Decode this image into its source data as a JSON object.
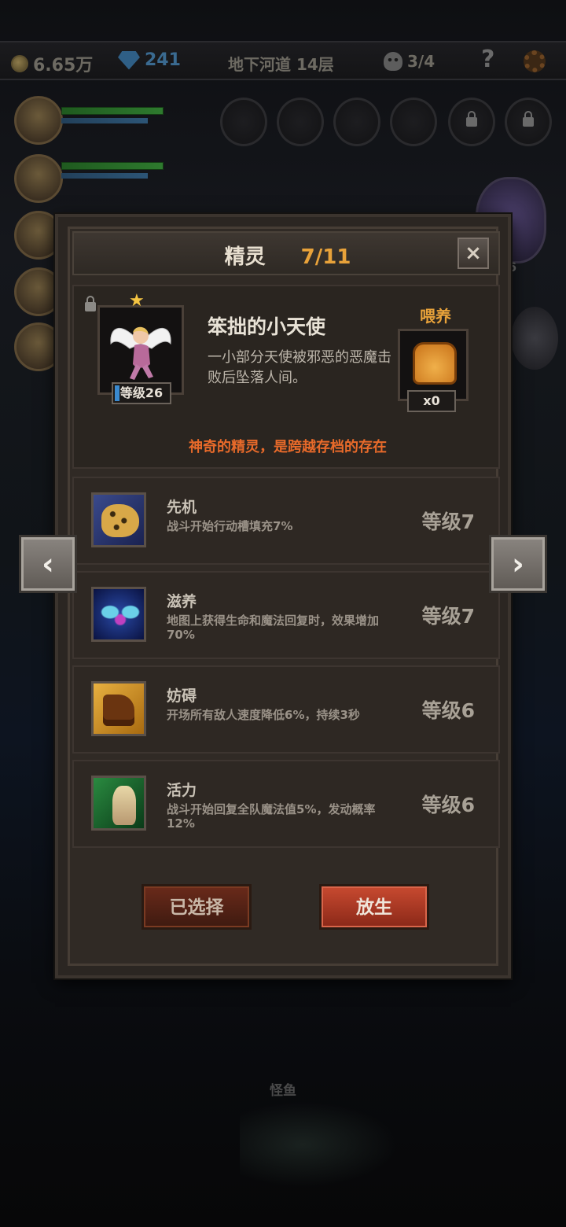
{
  "status_bar": {
    "gold": "6.65万",
    "gems": "241",
    "location": "地下河道 14层",
    "skull_progress": "3/4",
    "help": "?"
  },
  "background": {
    "monster_label": "怪鱼",
    "side_badge": "6"
  },
  "dialog": {
    "title": "精灵",
    "count": "7/11",
    "close": "×",
    "spirit": {
      "name": "笨拙的小天使",
      "description": "一小部分天使被邪恶的恶魔击败后坠落人间。",
      "level": "等级26",
      "stars": 1,
      "locked": true
    },
    "feed": {
      "label": "喂养",
      "item": "bread-icon",
      "count": "x0"
    },
    "flavor": "神奇的精灵，是跨越存档的存在",
    "skills": [
      {
        "name": "先机",
        "desc": "战斗开始行动槽填充7%",
        "level": "等级7",
        "icon": "leopard-icon"
      },
      {
        "name": "滋养",
        "desc": "地图上获得生命和魔法回复时，效果增加70%",
        "level": "等级7",
        "icon": "fairy-icon"
      },
      {
        "name": "妨碍",
        "desc": "开场所有敌人速度降低6%，持续3秒",
        "level": "等级6",
        "icon": "chained-boot-icon"
      },
      {
        "name": "活力",
        "desc": "战斗开始回复全队魔法值5%，发动概率12%",
        "level": "等级6",
        "icon": "vitality-icon"
      }
    ],
    "buttons": {
      "selected": "已选择",
      "release": "放生"
    },
    "nav": {
      "prev": "‹",
      "next": "›"
    }
  },
  "colors": {
    "accent_orange": "#e8a23a",
    "flavor_red": "#e86a2a",
    "release_button": "#c84a30"
  }
}
